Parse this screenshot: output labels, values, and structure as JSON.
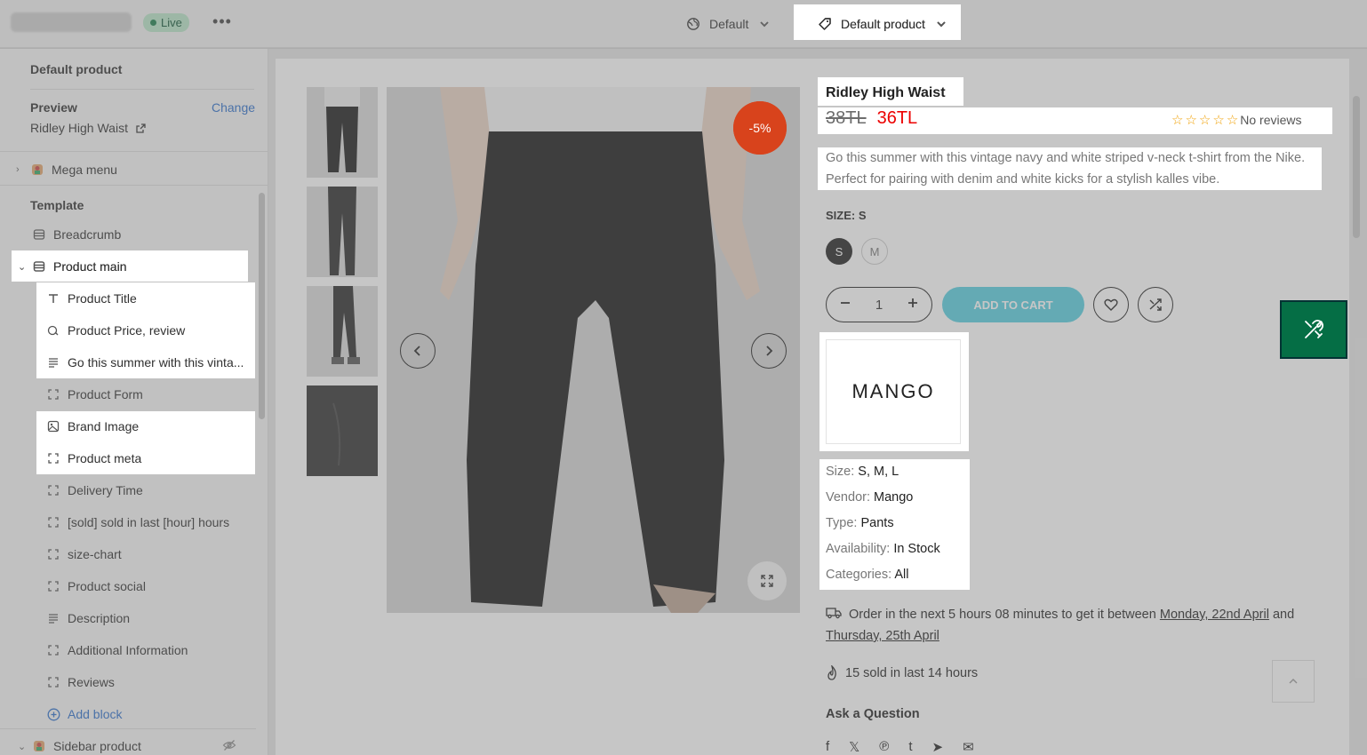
{
  "topbar": {
    "status": "Live",
    "more": "•••",
    "theme_select": "Default",
    "template_select": "Default product"
  },
  "sidebar": {
    "header": "Default product",
    "preview_label": "Preview",
    "change_label": "Change",
    "preview_value": "Ridley High Waist",
    "mega_menu": "Mega menu",
    "template_title": "Template",
    "breadcrumb": "Breadcrumb",
    "product_main": "Product main",
    "blocks": [
      {
        "label": "Product Title",
        "icon": "text-icon"
      },
      {
        "label": "Product Price, review",
        "icon": "price-tag-icon"
      },
      {
        "label": "Go this summer with this vinta...",
        "icon": "paragraph-icon"
      },
      {
        "label": "Product Form",
        "icon": "block-icon"
      },
      {
        "label": "Brand Image",
        "icon": "image-icon"
      },
      {
        "label": "Product meta",
        "icon": "block-icon"
      },
      {
        "label": "Delivery Time",
        "icon": "block-icon"
      },
      {
        "label": "[sold] sold in last [hour] hours",
        "icon": "block-icon"
      },
      {
        "label": "size-chart",
        "icon": "block-icon"
      },
      {
        "label": "Product social",
        "icon": "block-icon"
      },
      {
        "label": "Description",
        "icon": "paragraph-icon"
      },
      {
        "label": "Additional Information",
        "icon": "block-icon"
      },
      {
        "label": "Reviews",
        "icon": "block-icon"
      }
    ],
    "add_block": "Add block",
    "sidebar_product": "Sidebar product"
  },
  "product": {
    "sale_badge": "-5%",
    "title": "Ridley High Waist",
    "old_price": "38TL",
    "new_price": "36TL",
    "reviews_text": "No reviews",
    "description": "Go this summer with this vintage navy and white striped v-neck t-shirt from the Nike. Perfect for pairing with denim and white kicks for a stylish kalles vibe.",
    "size_label": "SIZE: S",
    "sizes": [
      "S",
      "M"
    ],
    "quantity": "1",
    "add_to_cart": "ADD TO CART",
    "brand": "MANGO",
    "meta": [
      {
        "key": "Size:",
        "value": "S, M, L"
      },
      {
        "key": "Vendor:",
        "value": "Mango"
      },
      {
        "key": "Type:",
        "value": "Pants"
      },
      {
        "key": "Availability:",
        "value": "In Stock"
      },
      {
        "key": "Categories:",
        "value": "All"
      }
    ],
    "delivery_prefix": "Order in the next 5 hours 08 minutes to get it between",
    "delivery_date1": "Monday, 22nd April",
    "delivery_and": "and",
    "delivery_date2": "Thursday, 25th April",
    "sold_count": "15",
    "sold_mid": "sold in last",
    "sold_hours": "14",
    "sold_suffix": "hours",
    "ask_question": "Ask a Question"
  },
  "colors": {
    "accent": "#2c6ecb",
    "sale": "#d8431c",
    "price": "#ec0101",
    "star": "#f1a208",
    "cart": "#56cfe1",
    "tool": "#056e45"
  }
}
